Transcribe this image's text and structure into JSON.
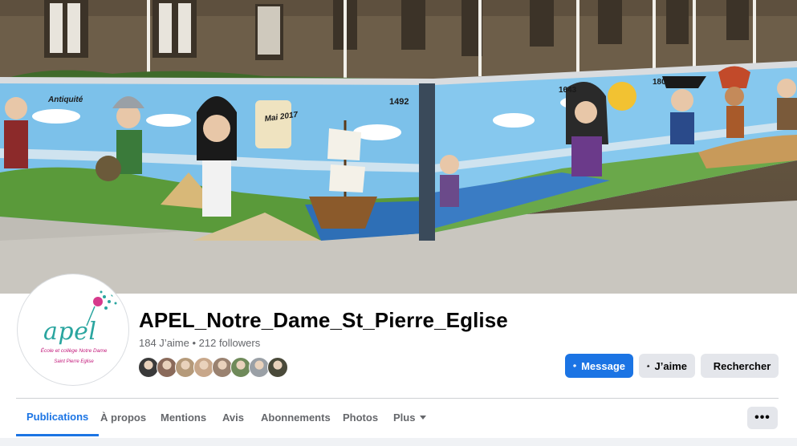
{
  "cover": {
    "mural_texts": [
      "Antiquité",
      "Mai 2017",
      "1492",
      "1643",
      "1804"
    ]
  },
  "profile": {
    "logo_word": "apel",
    "logo_line1": "École et collège Notre Dame",
    "logo_line2": "Saint Pierre Eglise",
    "name": "APEL_Notre_Dame_St_Pierre_Eglise",
    "stats": "184 J’aime • 212 followers",
    "friend_avatar_colors": [
      "#3a3a3a",
      "#8a6a5a",
      "#b59a7a",
      "#c8a78a",
      "#9a8270",
      "#6f8a5a",
      "#9aa0a6",
      "#4a4a3a"
    ]
  },
  "actions": {
    "message_label": "Message",
    "like_label": "J’aime",
    "search_label": "Rechercher"
  },
  "tabs": [
    {
      "label": "Publications",
      "active": true
    },
    {
      "label": "À propos",
      "active": false
    },
    {
      "label": "Mentions",
      "active": false
    },
    {
      "label": "Avis",
      "active": false
    },
    {
      "label": "Abonnements",
      "active": false
    },
    {
      "label": "Photos",
      "active": false
    },
    {
      "label": "Plus",
      "active": false
    }
  ],
  "more_button_label": "•••",
  "colors": {
    "accent": "#1b74e4",
    "secondary_button": "#e4e6eb",
    "muted_text": "#65676b",
    "logo_teal": "#2aa59f",
    "logo_magenta": "#c2187a"
  }
}
